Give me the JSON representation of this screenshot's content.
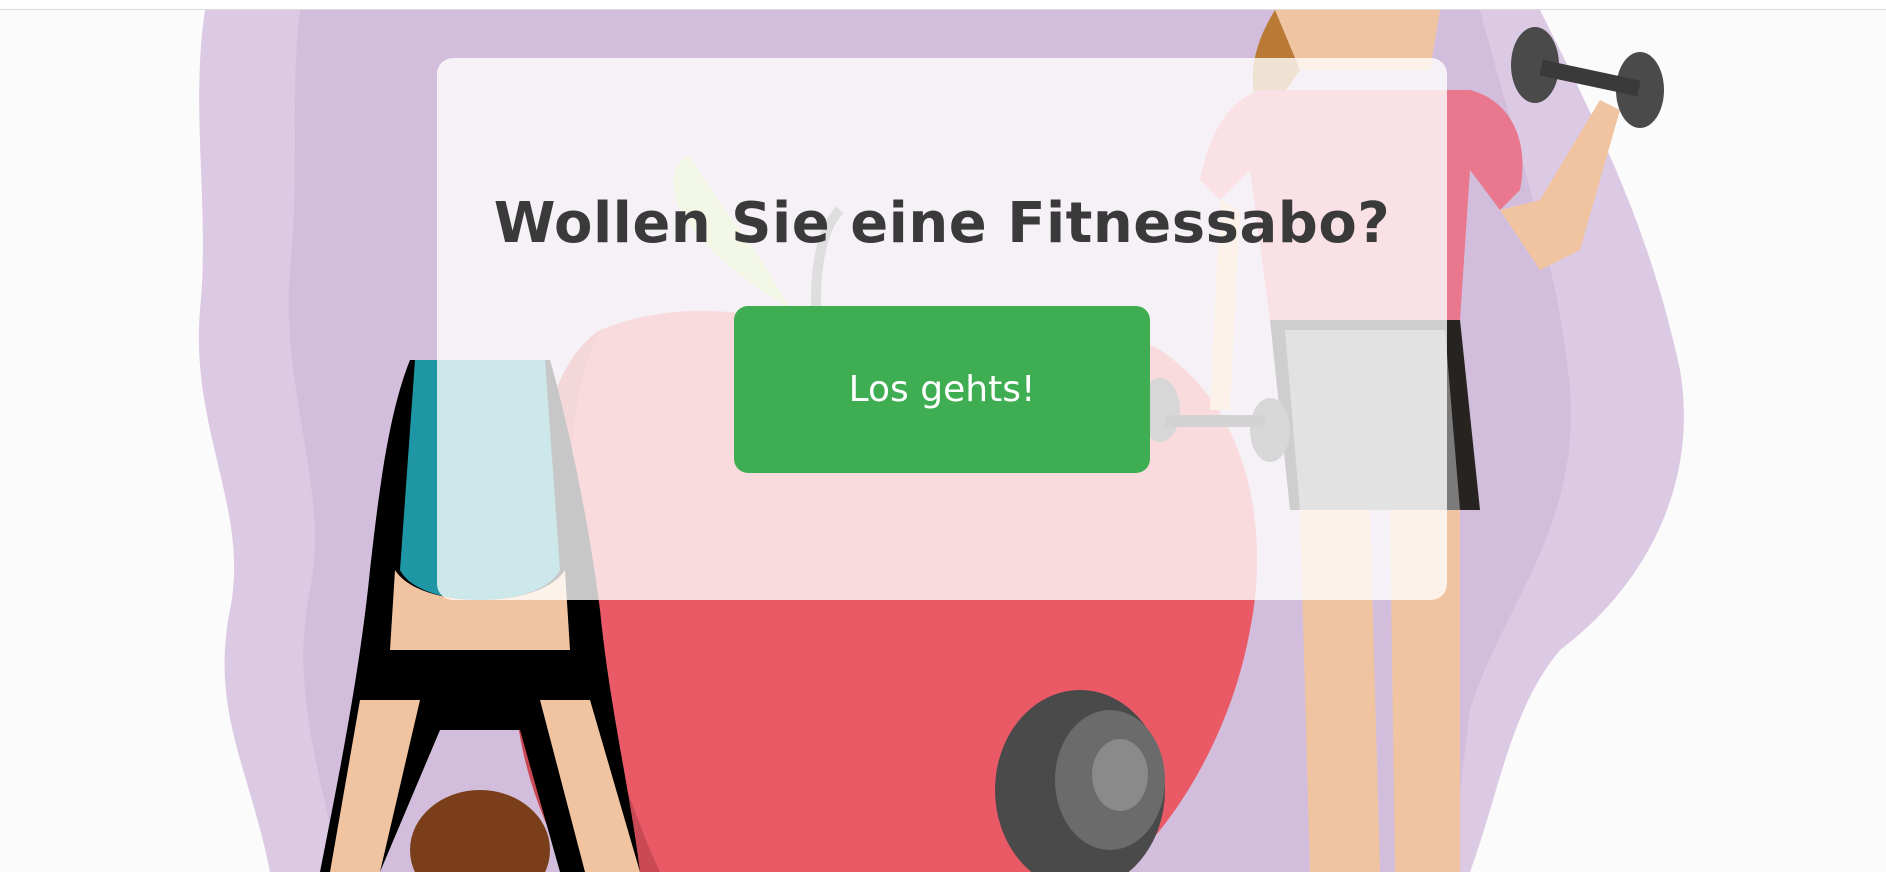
{
  "hero": {
    "headline": "Wollen Sie eine Fitnessabo?",
    "cta_label": "Los gehts!"
  },
  "colors": {
    "cta_background": "#3fae52",
    "headline_text": "#3a3a3a",
    "blob_purple": "#dcc9e3",
    "apple_red": "#e95a66",
    "shirt_pink": "#e9778e"
  },
  "illustration": {
    "icons": [
      "purple-blob-background",
      "apple-illustration",
      "dumbbell-icon",
      "woman-with-dumbbells-illustration",
      "yoga-woman-illustration"
    ]
  }
}
